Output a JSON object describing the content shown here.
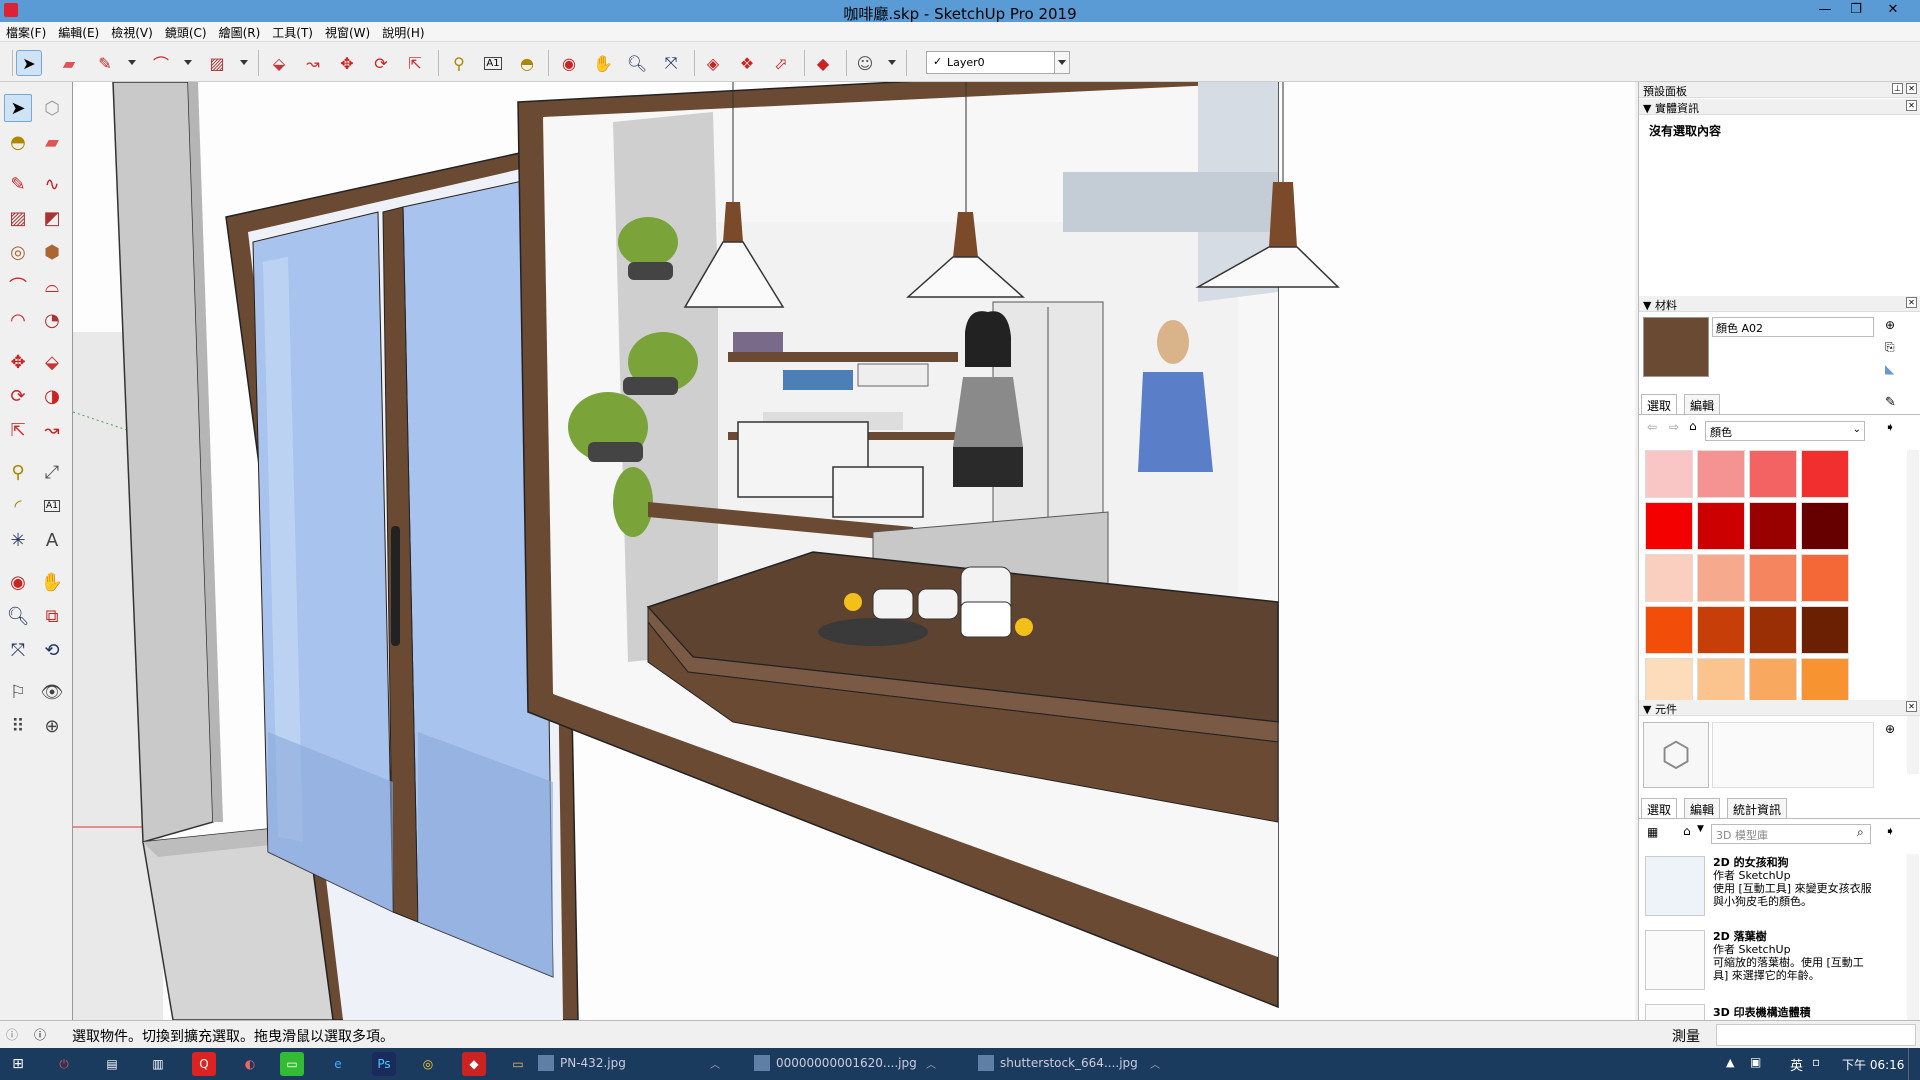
{
  "window": {
    "title": "咖啡廳.skp - SketchUp Pro 2019",
    "controls": [
      "—",
      "❐",
      "✕"
    ]
  },
  "menu": [
    "檔案(F)",
    "編輯(E)",
    "檢視(V)",
    "鏡頭(C)",
    "繪圖(R)",
    "工具(T)",
    "視窗(W)",
    "說明(H)"
  ],
  "toolbar": {
    "layer": "Layer0",
    "layer_check": "✓"
  },
  "panel": {
    "tray_title": "預設面板",
    "entity_info": {
      "title": "實體資訊",
      "content": "沒有選取內容"
    },
    "materials": {
      "title": "材料",
      "name_value": "顏色 A02",
      "tabs": [
        "選取",
        "編輯"
      ],
      "collection": "顏色",
      "swatches": [
        "#f9c5c5",
        "#f59393",
        "#f36363",
        "#f22f2f",
        "#f50000",
        "#cc0000",
        "#990000",
        "#660000",
        "#fbcfc0",
        "#f7a98d",
        "#f5855f",
        "#f46736",
        "#f24e0a",
        "#c83e08",
        "#9a2e05",
        "#6b1f03",
        "#fddcbc",
        "#fbc38e",
        "#f8a95f",
        "#f79331"
      ]
    },
    "components": {
      "title": "元件",
      "tabs": [
        "選取",
        "編輯",
        "統計資訊"
      ],
      "search_placeholder": "3D 模型庫",
      "items": [
        {
          "name": "2D 的女孩和狗",
          "author": "作者 SketchUp",
          "desc_1": "使用 [互動工具] 來變更女孩衣服",
          "desc_2": "與小狗皮毛的顏色。"
        },
        {
          "name": "2D 落葉樹",
          "author": "作者 SketchUp",
          "desc_1": "可縮放的落葉樹。使用 [互動工",
          "desc_2": "具] 來選擇它的年齡。"
        },
        {
          "name": "3D 印表機構造體積",
          "author": "",
          "desc_1": "",
          "desc_2": ""
        }
      ]
    }
  },
  "status": {
    "message": "選取物件。切換到擴充選取。拖曳滑鼠以選取多項。",
    "measure_label": "測量"
  },
  "taskbar": {
    "windows": [
      "PN-432.jpg",
      "00000000001620....jpg",
      "shutterstock_664....jpg"
    ],
    "ime": "英",
    "clock": "下午 06:16"
  },
  "colors": {
    "title_bar": "#5b9bd5",
    "taskbar": "#1a3b5e",
    "wood": "#6b4a34",
    "glass": "#a8c4ee"
  }
}
